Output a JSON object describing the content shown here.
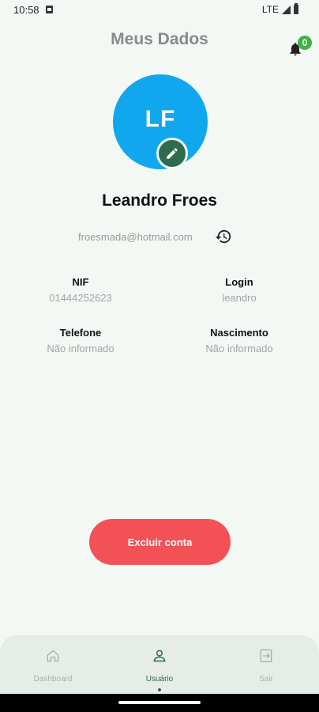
{
  "status_bar": {
    "time": "10:58",
    "network": "LTE"
  },
  "header": {
    "title": "Meus Dados",
    "notification_count": "0"
  },
  "profile": {
    "initials": "LF",
    "avatar_color": "#11a7ee",
    "name": "Leandro Froes",
    "email": "froesmada@hotmail.com"
  },
  "info": {
    "nif_label": "NIF",
    "nif_value": "01444252623",
    "login_label": "Login",
    "login_value": "leandro",
    "phone_label": "Telefone",
    "phone_value": "Não informado",
    "birth_label": "Nascimento",
    "birth_value": "Não informado"
  },
  "actions": {
    "delete_label": "Excluir conta",
    "delete_color": "#f25255"
  },
  "bottom_nav": {
    "active_color": "#2f6b4f",
    "items": [
      {
        "label": "Dashboard",
        "icon": "home-icon"
      },
      {
        "label": "Usuário",
        "icon": "person-icon"
      },
      {
        "label": "Sair",
        "icon": "logout-icon"
      }
    ]
  }
}
